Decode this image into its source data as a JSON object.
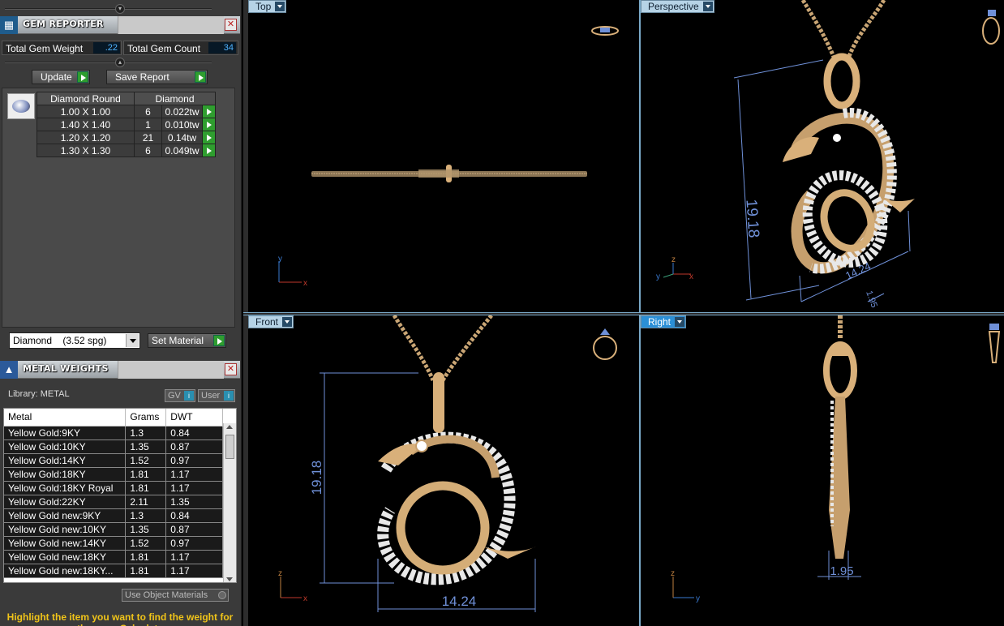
{
  "gem_reporter": {
    "title": "GEM REPORTER",
    "total_weight_label": "Total Gem Weight",
    "total_weight_value": ".22",
    "total_count_label": "Total Gem Count",
    "total_count_value": "34",
    "update_label": "Update",
    "save_report_label": "Save Report",
    "table_headers": [
      "Diamond Round",
      "Diamond"
    ],
    "rows": [
      {
        "size": "1.00 X 1.00",
        "count": "6",
        "weight": "0.022tw"
      },
      {
        "size": "1.40 X 1.40",
        "count": "1",
        "weight": "0.010tw"
      },
      {
        "size": "1.20 X 1.20",
        "count": "21",
        "weight": "0.14tw"
      },
      {
        "size": "1.30 X 1.30",
        "count": "6",
        "weight": "0.049tw"
      }
    ],
    "material_select": "Diamond    (3.52 spg)",
    "set_material_label": "Set Material"
  },
  "metal_weights": {
    "title": "METAL WEIGHTS",
    "library_label": "Library: METAL",
    "gv_label": "GV",
    "user_label": "User",
    "columns": [
      "Metal",
      "Grams",
      "DWT"
    ],
    "rows": [
      {
        "metal": "Yellow Gold:9KY",
        "grams": "1.3",
        "dwt": "0.84"
      },
      {
        "metal": "Yellow Gold:10KY",
        "grams": "1.35",
        "dwt": "0.87"
      },
      {
        "metal": "Yellow Gold:14KY",
        "grams": "1.52",
        "dwt": "0.97"
      },
      {
        "metal": "Yellow Gold:18KY",
        "grams": "1.81",
        "dwt": "1.17"
      },
      {
        "metal": "Yellow Gold:18KY Royal",
        "grams": "1.81",
        "dwt": "1.17"
      },
      {
        "metal": "Yellow Gold:22KY",
        "grams": "2.11",
        "dwt": "1.35"
      },
      {
        "metal": "Yellow Gold new:9KY",
        "grams": "1.3",
        "dwt": "0.84"
      },
      {
        "metal": "Yellow Gold new:10KY",
        "grams": "1.35",
        "dwt": "0.87"
      },
      {
        "metal": "Yellow Gold new:14KY",
        "grams": "1.52",
        "dwt": "0.97"
      },
      {
        "metal": "Yellow Gold new:18KY",
        "grams": "1.81",
        "dwt": "1.17"
      },
      {
        "metal": "Yellow Gold new:18KY...",
        "grams": "1.81",
        "dwt": "1.17"
      }
    ],
    "use_object_materials_label": "Use Object Materials",
    "hint": "Highlight the item you want to find the weight for then use Calculate"
  },
  "viewports": {
    "top": {
      "label": "Top"
    },
    "perspective": {
      "label": "Perspective"
    },
    "front": {
      "label": "Front"
    },
    "right": {
      "label": "Right"
    }
  },
  "dimensions": {
    "height": "19.18",
    "width": "14.24",
    "thickness": "1.95",
    "persp_small": "1.95"
  },
  "axes": {
    "x": "x",
    "y": "y",
    "z": "z"
  },
  "colors": {
    "accent": "#2b8fd6",
    "gold": "#d9b07a",
    "dimension": "#6f90d8",
    "hint": "#f0c419",
    "go_button": "#2f9e2f"
  }
}
